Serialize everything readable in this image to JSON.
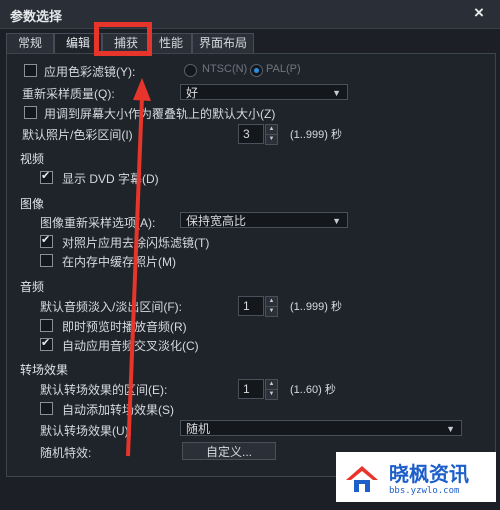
{
  "window": {
    "title": "参数选择",
    "close_glyph": "×"
  },
  "tabs": [
    {
      "label": "常规"
    },
    {
      "label": "编辑"
    },
    {
      "label": "捕获"
    },
    {
      "label": "性能"
    },
    {
      "label": "界面布局"
    }
  ],
  "active_tab": "编辑",
  "edit": {
    "apply_color_filter": {
      "label": "应用色彩滤镜(Y):",
      "checked": false
    },
    "ntsc": {
      "label": "NTSC(N)",
      "selected": false
    },
    "pal": {
      "label": "PAL(P)",
      "selected": true
    },
    "resample_quality": {
      "label": "重新采样质量(Q):",
      "value": "好"
    },
    "fit_to_screen": {
      "label": "用调到屏幕大小作为覆叠轨上的默认大小(Z)",
      "checked": false
    },
    "default_interval": {
      "label": "默认照片/色彩区间(I)",
      "value": "3",
      "range": "(1..999) 秒"
    },
    "video_section": "视频",
    "show_dvd_subtitles": {
      "label": "显示 DVD 字幕(D)",
      "checked": true
    },
    "image_section": "图像",
    "image_resample": {
      "label": "图像重新采样选项(A):",
      "value": "保持宽高比"
    },
    "anti_flicker": {
      "label": "对照片应用去除闪烁滤镜(T)",
      "checked": true
    },
    "cache_photos": {
      "label": "在内存中缓存照片(M)",
      "checked": false
    },
    "audio_section": "音频",
    "audio_fade": {
      "label": "默认音频淡入/淡出区间(F):",
      "value": "1",
      "range": "(1..999) 秒"
    },
    "instant_preview": {
      "label": "即时预览时播放音频(R)",
      "checked": false
    },
    "audio_crossfade": {
      "label": "自动应用音频交叉淡化(C)",
      "checked": true
    },
    "transition_section": "转场效果",
    "transition_interval": {
      "label": "默认转场效果的区间(E):",
      "value": "1",
      "range": "(1..60) 秒"
    },
    "auto_add_transition": {
      "label": "自动添加转场效果(S)",
      "checked": false
    },
    "default_transition": {
      "label": "默认转场效果(U):",
      "value": "随机"
    },
    "random_effects": {
      "label": "随机特效:",
      "button": "自定义..."
    }
  },
  "watermark": {
    "title": "晓枫资讯",
    "url": "bbs.yzwlo.com"
  },
  "colors": {
    "highlight": "#e8352b",
    "accent": "#2c8de0",
    "watermark": "#1d5fc9"
  }
}
